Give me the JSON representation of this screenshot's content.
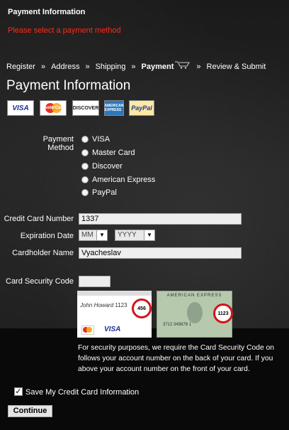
{
  "header": {
    "title": "Payment Information",
    "error": "Please select a payment method"
  },
  "breadcrumb": {
    "items": [
      "Register",
      "Address",
      "Shipping",
      "Payment",
      "Review & Submit"
    ],
    "separator": "»",
    "active_index": 3
  },
  "page_title": "Payment Information",
  "card_logos": {
    "visa": "VISA",
    "mastercard": "MasterCard",
    "discover": "DISCOVER",
    "amex": "AMERICAN EXPRESS",
    "paypal": "PayPal"
  },
  "form": {
    "payment_method_label": "Payment Method",
    "payment_methods": [
      "VISA",
      "Master Card",
      "Discover",
      "American Express",
      "PayPal"
    ],
    "cc_number_label": "Credit Card Number",
    "cc_number_value": "1337",
    "expiration_label": "Expiration Date",
    "exp_month": "MM",
    "exp_year": "YYYY",
    "cardholder_label": "Cardholder Name",
    "cardholder_value": "Vyacheslav",
    "security_code_label": "Card Security Code",
    "security_code_value": ""
  },
  "cvv_illustration": {
    "back_digits": "1123",
    "back_code": "456",
    "front_code": "1123",
    "front_number": "3712  345678  1",
    "back_brand_visa": "VISA"
  },
  "security_note": {
    "line1": "For security purposes, we require the Card Security Code on",
    "line2": "follows your account number on the back of your card. If you",
    "line3": "above your account number on the front of your card."
  },
  "save_card": {
    "checked": true,
    "label": "Save My Credit Card Information"
  },
  "continue_button": "Continue",
  "colors": {
    "error": "#ff2a1a",
    "cvv_circle": "#d0161a",
    "background": "#141414"
  }
}
